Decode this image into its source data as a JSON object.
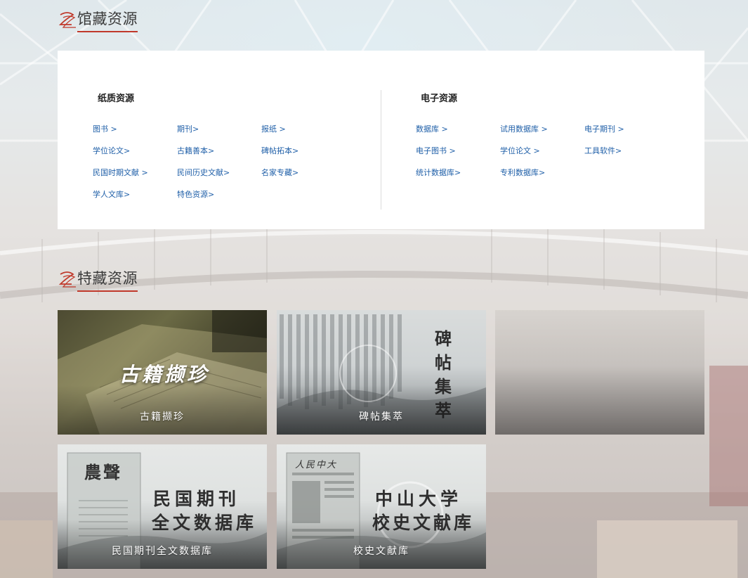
{
  "sections": {
    "holdings": {
      "title": "馆藏资源"
    },
    "special": {
      "title": "特藏资源"
    }
  },
  "paper": {
    "heading": "纸质资源",
    "rows": [
      [
        "图书 >",
        "期刊>",
        "报纸 >"
      ],
      [
        "学位论文>",
        "古籍善本>",
        "碑帖拓本>"
      ],
      [
        "民国时期文献 >",
        "民间历史文献>",
        "名家专藏>"
      ],
      [
        "学人文库>",
        "特色资源>"
      ]
    ]
  },
  "electronic": {
    "heading": "电子资源",
    "rows": [
      [
        "数据库 >",
        "试用数据库 >",
        "电子期刊 >"
      ],
      [
        "电子图书 >",
        "学位论文 >",
        "工具软件>"
      ],
      [
        "统计数据库>",
        "专利数据库>"
      ]
    ]
  },
  "cards": {
    "guji": {
      "banner": "古籍撷珍",
      "caption": "古籍撷珍"
    },
    "beitie": {
      "banner": [
        "碑",
        "帖",
        "集",
        "萃"
      ],
      "caption": "碑帖集萃"
    },
    "minguo": {
      "banner_line1": "民国期刊",
      "banner_line2": "全文数据库",
      "caption": "民国期刊全文数据库",
      "masthead": "農聲"
    },
    "xiaoshi": {
      "banner_line1": "中山大学",
      "banner_line2": "校史文献库",
      "caption": "校史文献库",
      "masthead": "人民中大"
    }
  },
  "colors": {
    "link": "#1f5fa8",
    "accent": "#c0392b",
    "heading": "#222222"
  },
  "icons": {
    "section_logo": "swirl-logo-icon"
  }
}
